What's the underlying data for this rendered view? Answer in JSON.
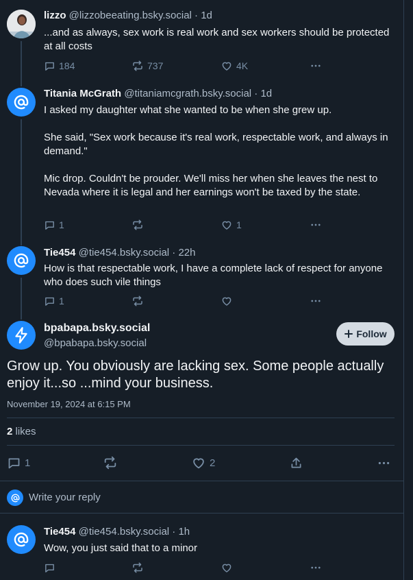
{
  "posts": [
    {
      "name": "lizzo",
      "handle": "@lizzobeeating.bsky.social",
      "time": "· 1d",
      "text": "...and as always, sex work is real work and sex workers should be protected at all costs",
      "replies": "184",
      "reposts": "737",
      "likes": "4K"
    },
    {
      "name": "Titania McGrath",
      "handle": "@titaniamcgrath.bsky.social",
      "time": "· 1d",
      "text": "I asked my daughter what she wanted to be when she grew up.\n\nShe said, \"Sex work because it's real work, respectable work, and always in demand.\"\n\nMic drop. Couldn't be prouder. We'll miss her when she leaves the nest to Nevada where it is legal and her earnings won't be taxed by the state.",
      "replies": "1",
      "reposts": "",
      "likes": "1"
    },
    {
      "name": "Tie454",
      "handle": "@tie454.bsky.social",
      "time": "· 22h",
      "text": "How is that respectable work, I have a complete lack of respect for anyone who does such vile things",
      "replies": "1",
      "reposts": "",
      "likes": ""
    }
  ],
  "main_post": {
    "name": "bpabapa.bsky.social",
    "handle": "@bpabapa.bsky.social",
    "follow_label": "Follow",
    "text": "Grow up. You obviously are lacking sex. Some people actually enjoy it...so ...mind your business.",
    "timestamp": "November 19, 2024 at 6:15 PM",
    "likes_count": "2",
    "likes_label": "likes",
    "replies": "1",
    "likes": "2"
  },
  "reply_box": {
    "placeholder": "Write your reply"
  },
  "reply": {
    "name": "Tie454",
    "handle": "@tie454.bsky.social",
    "time": "· 1h",
    "text": "Wow, you just said that to a minor"
  },
  "colors": {
    "accent": "#208bfe",
    "background": "#161e27",
    "muted": "#788ea5"
  },
  "icons": [
    "at-sign-icon",
    "lightning-icon",
    "reply-icon",
    "repost-icon",
    "like-icon",
    "more-icon",
    "share-icon",
    "plus-icon"
  ]
}
